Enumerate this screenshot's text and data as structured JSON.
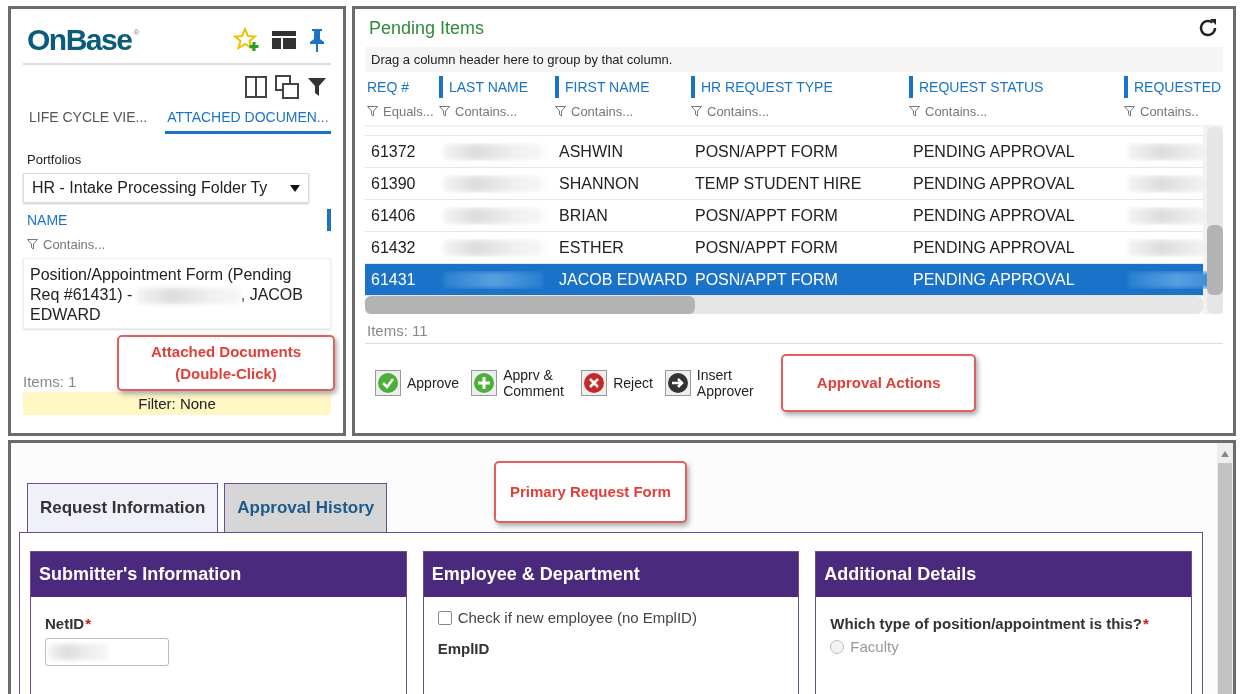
{
  "left_panel": {
    "logo": "OnBase",
    "logo_mark": "®",
    "tabs": [
      {
        "label": "LIFE CYCLE VIE...",
        "selected": false
      },
      {
        "label": "ATTACHED DOCUMEN...",
        "selected": true
      }
    ],
    "portfolios_label": "Portfolios",
    "portfolio_select": "HR - Intake Processing Folder Ty",
    "name_column": "NAME",
    "name_filter": "Contains...",
    "document": {
      "before": "Position/Appointment Form (Pending Req #61431) -",
      "after": ", JACOB EDWARD"
    },
    "items": "Items: 1",
    "filter": "Filter: None",
    "callout": "Attached Documents (Double-Click)"
  },
  "pending": {
    "title": "Pending Items",
    "group_hint": "Drag a column header here to group by that column.",
    "columns": [
      {
        "label": "REQ #",
        "filter": "Equals..."
      },
      {
        "label": "LAST NAME",
        "filter": "Contains..."
      },
      {
        "label": "FIRST NAME",
        "filter": "Contains..."
      },
      {
        "label": "HR REQUEST TYPE",
        "filter": "Contains..."
      },
      {
        "label": "REQUEST STATUS",
        "filter": "Contains..."
      },
      {
        "label": "REQUESTED",
        "filter": "Contains.."
      }
    ],
    "rows": [
      {
        "req": "61372",
        "first": "ASHWIN",
        "type": "POSN/APPT FORM",
        "status": "PENDING APPROVAL",
        "selected": false
      },
      {
        "req": "61390",
        "first": "SHANNON",
        "type": "TEMP STUDENT HIRE",
        "status": "PENDING APPROVAL",
        "selected": false
      },
      {
        "req": "61406",
        "first": "BRIAN",
        "type": "POSN/APPT FORM",
        "status": "PENDING APPROVAL",
        "selected": false
      },
      {
        "req": "61432",
        "first": "ESTHER",
        "type": "POSN/APPT FORM",
        "status": "PENDING APPROVAL",
        "selected": false
      },
      {
        "req": "61431",
        "first": "JACOB EDWARD",
        "type": "POSN/APPT FORM",
        "status": "PENDING APPROVAL",
        "selected": true
      }
    ],
    "items": "Items: 11",
    "actions": [
      {
        "kind": "approve",
        "label": "Approve"
      },
      {
        "kind": "comment",
        "label": "Apprv & Comment"
      },
      {
        "kind": "reject",
        "label": "Reject"
      },
      {
        "kind": "insert",
        "label": "Insert Approver"
      }
    ],
    "callout": "Approval Actions"
  },
  "form": {
    "callout": "Primary Request Form",
    "tabs": [
      {
        "label": "Request Information",
        "selected": true
      },
      {
        "label": "Approval History",
        "selected": false
      }
    ],
    "sections": [
      {
        "kind": "submitter",
        "title": "Submitter's Information",
        "field_label": "NetID",
        "required_mark": "*"
      },
      {
        "kind": "employee",
        "title": "Employee & Department",
        "checkbox": "Check if new employee (no EmplID)",
        "checked": false,
        "field_label": "EmplID"
      },
      {
        "kind": "details",
        "title": "Additional Details",
        "question": "Which type of position/appointment is this?",
        "required_mark": "*",
        "options": [
          {
            "label": "Faculty",
            "selected": false
          }
        ]
      }
    ]
  }
}
